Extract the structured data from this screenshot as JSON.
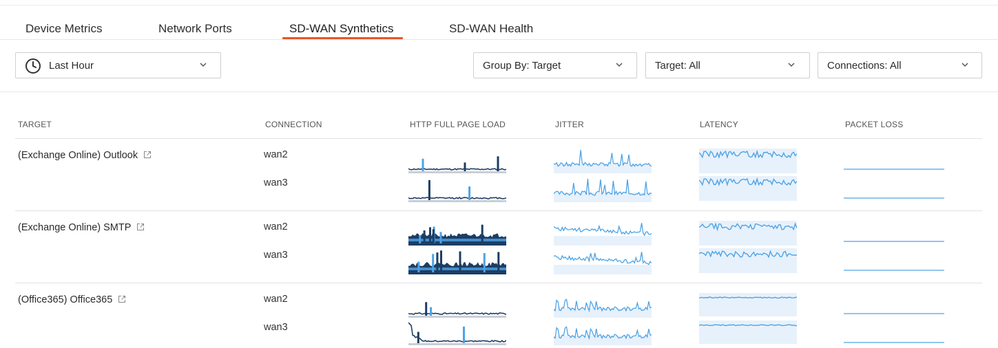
{
  "tabs": [
    {
      "label": "Device Metrics"
    },
    {
      "label": "Network Ports"
    },
    {
      "label": "SD-WAN Synthetics",
      "active": true
    },
    {
      "label": "SD-WAN Health"
    }
  ],
  "filters": {
    "time_range": "Last Hour",
    "group_by": "Group By: Target",
    "target": "Target: All",
    "connections": "Connections: All"
  },
  "columns": {
    "target": "TARGET",
    "connection": "CONNECTION",
    "http": "HTTP FULL PAGE LOAD",
    "jitter": "JITTER",
    "latency": "LATENCY",
    "packet_loss": "PACKET LOSS"
  },
  "rows": [
    {
      "target": "(Exchange Online) Outlook",
      "connections": [
        "wan2",
        "wan3"
      ]
    },
    {
      "target": "(Exchange Online) SMTP",
      "connections": [
        "wan2",
        "wan3"
      ]
    },
    {
      "target": "(Office365) Office365",
      "connections": [
        "wan2",
        "wan3"
      ]
    }
  ],
  "colors": {
    "accent_tab": "#e8552a",
    "spark_dark": "#1d3d63",
    "spark_light": "#4da3e6",
    "spark_band": "#e7f1fb"
  }
}
